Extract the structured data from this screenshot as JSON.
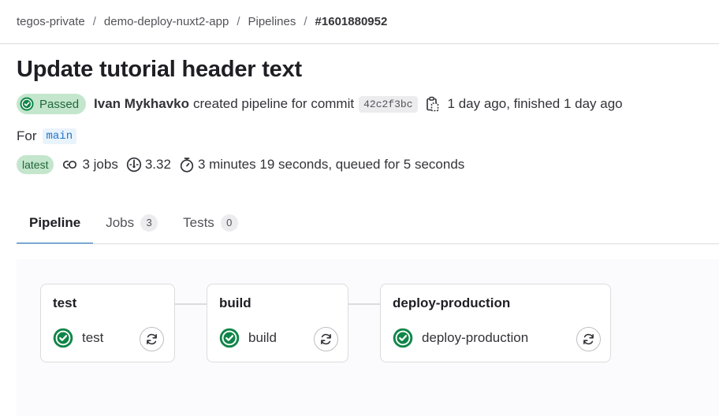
{
  "breadcrumb": {
    "items": [
      "tegos-private",
      "demo-deploy-nuxt2-app",
      "Pipelines"
    ],
    "separator": "/",
    "current": "#1601880952"
  },
  "pipeline": {
    "title": "Update tutorial header text",
    "status": "Passed",
    "author": "Ivan Mykhavko",
    "action_text": "created pipeline for commit",
    "commit_sha": "42c2f3bc",
    "time_text": "1 day ago, finished 1 day ago",
    "for_label": "For",
    "branch": "main",
    "latest_label": "latest",
    "jobs_text": "3 jobs",
    "compute_text": "3.32",
    "duration_text": "3 minutes 19 seconds, queued for 5 seconds"
  },
  "tabs": [
    {
      "label": "Pipeline",
      "count": null,
      "active": true
    },
    {
      "label": "Jobs",
      "count": "3",
      "active": false
    },
    {
      "label": "Tests",
      "count": "0",
      "active": false
    }
  ],
  "stages": [
    {
      "name": "test",
      "jobs": [
        {
          "name": "test",
          "status": "success"
        }
      ]
    },
    {
      "name": "build",
      "jobs": [
        {
          "name": "build",
          "status": "success"
        }
      ]
    },
    {
      "name": "deploy-production",
      "jobs": [
        {
          "name": "deploy-production",
          "status": "success"
        }
      ]
    }
  ],
  "icons": {
    "status_success": "check-circle-icon",
    "copy": "copy-to-clipboard-icon",
    "jobs": "pipeline-icon",
    "compute": "compute-minutes-icon",
    "duration": "timer-icon",
    "retry": "retry-icon"
  },
  "colors": {
    "success_bg": "#c3e6cd",
    "success_fg": "#24663b",
    "success_icon": "#108548",
    "link": "#1f75cb",
    "tab_active_underline": "#1f75cb",
    "graph_bg": "#fbfafd"
  }
}
